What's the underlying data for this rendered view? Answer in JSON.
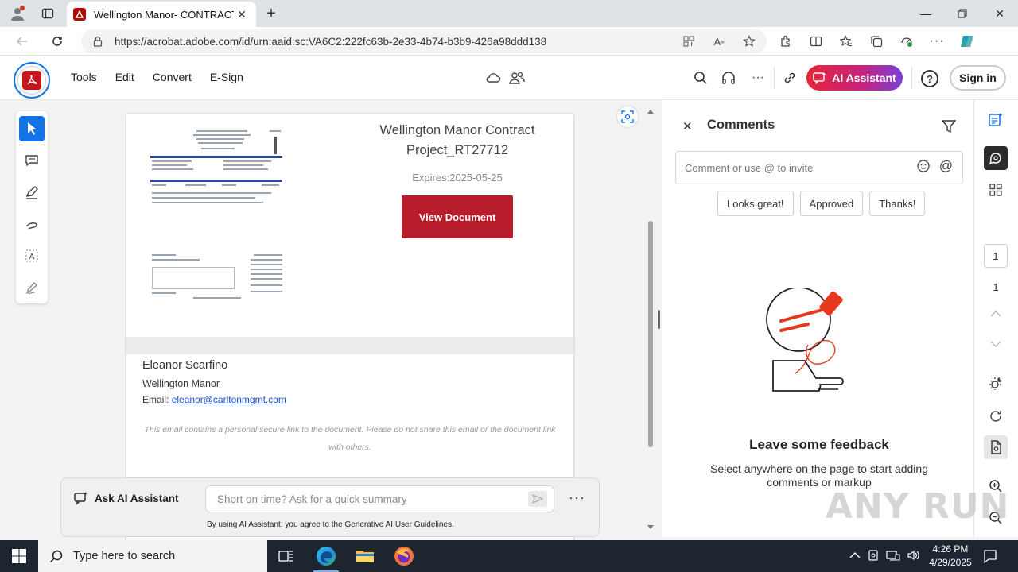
{
  "browser": {
    "tab_title": "Wellington Manor- CONTRACT P",
    "url": "https://acrobat.adobe.com/id/urn:aaid:sc:VA6C2:222fc63b-2e33-4b74-b3b9-426a98ddd138"
  },
  "acrobat": {
    "menu": [
      "Tools",
      "Edit",
      "Convert",
      "E-Sign"
    ],
    "ai_assistant_label": "AI Assistant",
    "help_label": "?",
    "sign_in_label": "Sign in"
  },
  "document": {
    "title": "Wellington Manor Contract Project_RT27712",
    "expires": "Expires:2025-05-25",
    "view_button": "View Document",
    "sender_name": "Eleanor Scarfino",
    "sender_org": "Wellington Manor",
    "email_label": "Email:",
    "email": "eleanor@carltonmgmt.com",
    "disclaimer": "This email contains a personal secure link to the document. Please do not share this email or the document link with others."
  },
  "ai_bar": {
    "label": "Ask AI Assistant",
    "placeholder": "Short on time? Ask for a quick summary",
    "terms_prefix": "By using AI Assistant, you agree to the",
    "terms_link": "Generative AI User Guidelines",
    "terms_suffix": "."
  },
  "comments": {
    "title": "Comments",
    "input_placeholder": "Comment or use @ to invite",
    "chips": [
      "Looks great!",
      "Approved",
      "Thanks!"
    ],
    "empty_title": "Leave some feedback",
    "empty_subtitle": "Select anywhere on the page to start adding comments or markup"
  },
  "pager": {
    "current_page": "1",
    "total_pages": "1"
  },
  "watermark": "ANY RUN",
  "taskbar": {
    "search_placeholder": "Type here to search",
    "time": "4:26 PM",
    "date": "4/29/2025"
  },
  "colors": {
    "acrobat_red": "#c4161c",
    "view_button": "#b71c2a",
    "active_tool": "#1473e6",
    "taskbar": "#1c2530"
  }
}
